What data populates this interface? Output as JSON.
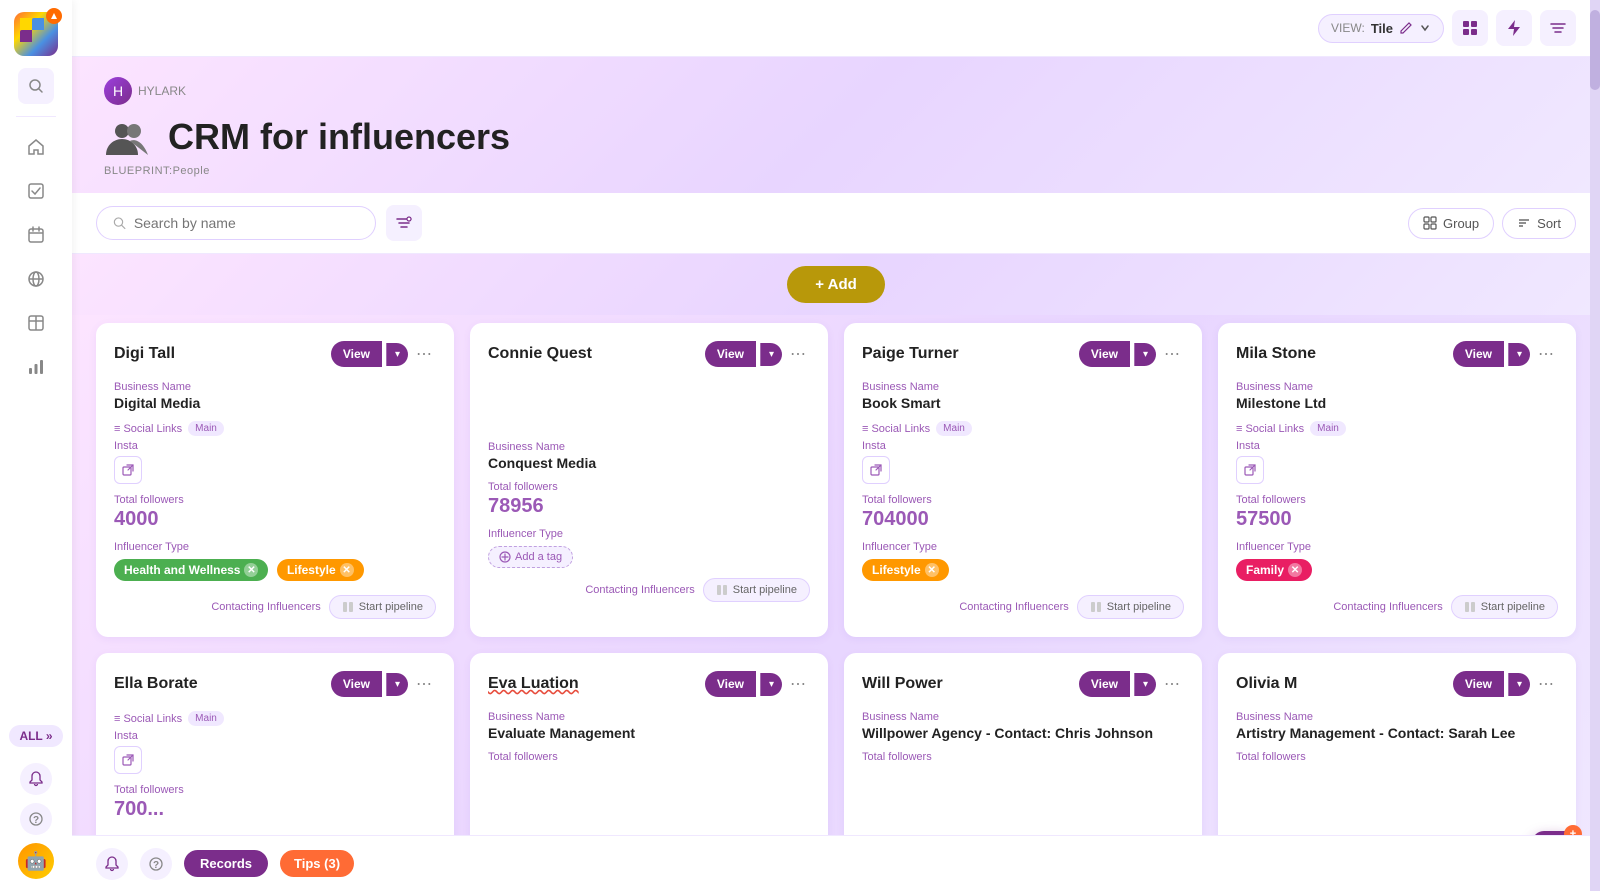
{
  "app": {
    "name": "HYLARK",
    "title": "CRM for influencers",
    "blueprint": "BLUEPRINT:People"
  },
  "topbar": {
    "view_label": "VIEW:",
    "view_name": "Tile",
    "edit_icon": "pencil-icon",
    "dropdown_icon": "chevron-down-icon",
    "grid_icon": "grid-icon",
    "bolt_icon": "bolt-icon",
    "filter2_icon": "filter2-icon"
  },
  "toolbar": {
    "search_placeholder": "Search by name",
    "group_label": "Group",
    "sort_label": "Sort"
  },
  "add_button": {
    "label": "+ Add"
  },
  "cards": [
    {
      "name": "Digi Tall",
      "business_name_label": "Business Name",
      "business_name": "Digital Media",
      "social_links_label": "Social Links",
      "social_main": "Main",
      "insta_label": "Insta",
      "followers_label": "Total followers",
      "followers": "4000",
      "type_label": "Influencer Type",
      "tags": [
        {
          "text": "Health and Wellness",
          "color": "green"
        },
        {
          "text": "Lifestyle",
          "color": "orange"
        }
      ],
      "pipeline_status": "Contacting Influencers",
      "pipeline_btn": "Start pipeline"
    },
    {
      "name": "Connie Quest",
      "business_name_label": "Business Name",
      "business_name": "Conquest Media",
      "followers_label": "Total followers",
      "followers": "78956",
      "type_label": "Influencer Type",
      "tags": [],
      "add_tag": "Add a tag",
      "pipeline_status": "Contacting Influencers",
      "pipeline_btn": "Start pipeline"
    },
    {
      "name": "Paige Turner",
      "business_name_label": "Business Name",
      "business_name": "Book Smart",
      "social_links_label": "Social Links",
      "social_main": "Main",
      "insta_label": "Insta",
      "followers_label": "Total followers",
      "followers": "704000",
      "type_label": "Influencer Type",
      "tags": [
        {
          "text": "Lifestyle",
          "color": "orange"
        }
      ],
      "pipeline_status": "Contacting Influencers",
      "pipeline_btn": "Start pipeline"
    },
    {
      "name": "Mila Stone",
      "business_name_label": "Business Name",
      "business_name": "Milestone Ltd",
      "social_links_label": "Social Links",
      "social_main": "Main",
      "insta_label": "Insta",
      "followers_label": "Total followers",
      "followers": "57500",
      "type_label": "Influencer Type",
      "tags": [
        {
          "text": "Family",
          "color": "pink"
        }
      ],
      "pipeline_status": "Contacting Influencers",
      "pipeline_btn": "Start pipeline"
    },
    {
      "name": "Ella Borate",
      "social_links_label": "Social Links",
      "social_main": "Main",
      "insta_label": "Insta",
      "followers_label": "Total followers",
      "followers": "700..."
    },
    {
      "name": "Eva Luation",
      "business_name_label": "Business Name",
      "business_name": "Evaluate Management",
      "followers_label": "Total followers",
      "followers": ""
    },
    {
      "name": "Will Power",
      "business_name_label": "Business Name",
      "business_name": "Willpower Agency - Contact: Chris Johnson",
      "followers_label": "Total followers",
      "followers": ""
    },
    {
      "name": "Olivia M",
      "business_name_label": "Business Name",
      "business_name": "Artistry Management - Contact: Sarah Lee",
      "followers_label": "Total followers",
      "followers": ""
    }
  ],
  "bottom": {
    "records_label": "Records",
    "tips_label": "Tips (3)"
  },
  "floating": {
    "badge": "+"
  }
}
